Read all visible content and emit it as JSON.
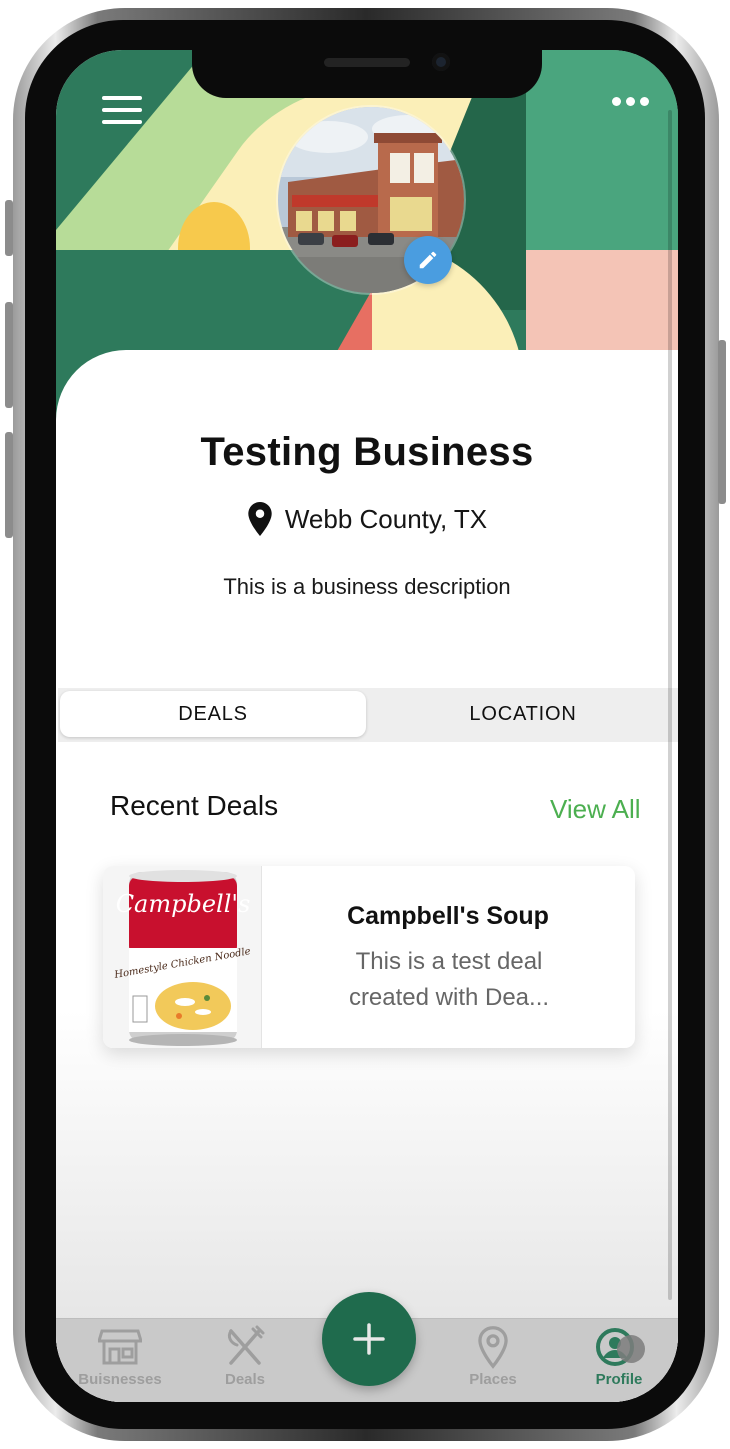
{
  "business": {
    "name": "Testing Business",
    "location": "Webb County, TX",
    "description": "This is a business description"
  },
  "tabs": [
    {
      "label": "DEALS",
      "active": true
    },
    {
      "label": "LOCATION",
      "active": false
    }
  ],
  "recent_deals": {
    "title": "Recent Deals",
    "view_all_label": "View All",
    "items": [
      {
        "title": "Campbell's Soup",
        "description": "This is a test deal created with Dea...",
        "image_brand": "Campbell's",
        "image_product": "Homestyle Chicken Noodle"
      }
    ]
  },
  "bottom_nav": [
    {
      "label": "Buisnesses",
      "icon": "storefront-icon",
      "active": false
    },
    {
      "label": "Deals",
      "icon": "fork-knife-icon",
      "active": false
    },
    {
      "label": "Places",
      "icon": "map-pin-icon",
      "active": false
    },
    {
      "label": "Profile",
      "icon": "profile-icon",
      "active": true
    }
  ],
  "icons": {
    "menu": "hamburger-menu-icon",
    "more": "more-dots-icon",
    "edit": "pencil-icon",
    "location": "location-pin-icon",
    "add": "plus-icon"
  },
  "colors": {
    "brand_green": "#2e7a5c",
    "accent_green": "#4caf50",
    "edit_blue": "#4a9de0",
    "header_light_green": "#b7dc98",
    "header_cream": "#fbefb8",
    "header_yellow": "#f7c94c",
    "header_coral": "#e76f62",
    "header_pink": "#f4c4b6",
    "header_mint": "#4aa57e"
  }
}
